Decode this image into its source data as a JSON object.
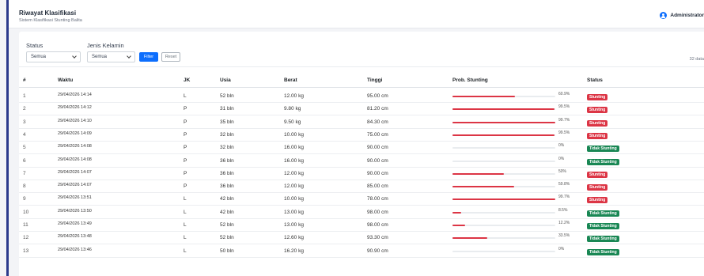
{
  "header": {
    "title": "Riwayat Klasifikasi",
    "subtitle": "Sistem Klasifikasi Stunting Balita",
    "user_name": "Administrator"
  },
  "filters": {
    "status_label": "Status",
    "status_value": "Semua",
    "gender_label": "Jenis Kelamin",
    "gender_value": "Semua",
    "filter_button": "Filter",
    "reset_button": "Reset",
    "count_text": "32 data"
  },
  "table": {
    "columns": [
      "#",
      "Waktu",
      "JK",
      "Usia",
      "Berat",
      "Tinggi",
      "Prob. Stunting",
      "Status"
    ],
    "rows": [
      {
        "no": "1",
        "time": "29/04/2026 14:14",
        "jk": "L",
        "usia": "52 bln",
        "berat": "12.00 kg",
        "tinggi": "95.00 cm",
        "prob": 60.9,
        "prob_text": "60.9%",
        "status": "Stunting",
        "positive": true
      },
      {
        "no": "2",
        "time": "29/04/2026 14:12",
        "jk": "P",
        "usia": "31 bln",
        "berat": "9.80 kg",
        "tinggi": "81.20 cm",
        "prob": 99.5,
        "prob_text": "99.5%",
        "status": "Stunting",
        "positive": true
      },
      {
        "no": "3",
        "time": "29/04/2026 14:10",
        "jk": "P",
        "usia": "35 bln",
        "berat": "9.50 kg",
        "tinggi": "84.30 cm",
        "prob": 99.7,
        "prob_text": "99.7%",
        "status": "Stunting",
        "positive": true
      },
      {
        "no": "4",
        "time": "29/04/2026 14:09",
        "jk": "P",
        "usia": "32 bln",
        "berat": "10.00 kg",
        "tinggi": "75.00 cm",
        "prob": 99.5,
        "prob_text": "99.5%",
        "status": "Stunting",
        "positive": true
      },
      {
        "no": "5",
        "time": "29/04/2026 14:08",
        "jk": "P",
        "usia": "32 bln",
        "berat": "16.00 kg",
        "tinggi": "90.00 cm",
        "prob": 0,
        "prob_text": "0%",
        "status": "Tidak Stunting",
        "positive": false
      },
      {
        "no": "6",
        "time": "29/04/2026 14:08",
        "jk": "P",
        "usia": "36 bln",
        "berat": "16.00 kg",
        "tinggi": "90.00 cm",
        "prob": 0,
        "prob_text": "0%",
        "status": "Tidak Stunting",
        "positive": false
      },
      {
        "no": "7",
        "time": "29/04/2026 14:07",
        "jk": "P",
        "usia": "36 bln",
        "berat": "12.00 kg",
        "tinggi": "90.00 cm",
        "prob": 50,
        "prob_text": "50%",
        "status": "Stunting",
        "positive": true
      },
      {
        "no": "8",
        "time": "29/04/2026 14:07",
        "jk": "P",
        "usia": "36 bln",
        "berat": "12.00 kg",
        "tinggi": "85.00 cm",
        "prob": 59.8,
        "prob_text": "59.8%",
        "status": "Stunting",
        "positive": true
      },
      {
        "no": "9",
        "time": "29/04/2026 13:51",
        "jk": "L",
        "usia": "42 bln",
        "berat": "10.00 kg",
        "tinggi": "78.00 cm",
        "prob": 99.7,
        "prob_text": "99.7%",
        "status": "Stunting",
        "positive": true
      },
      {
        "no": "10",
        "time": "29/04/2026 13:50",
        "jk": "L",
        "usia": "42 bln",
        "berat": "13.00 kg",
        "tinggi": "98.00 cm",
        "prob": 8.5,
        "prob_text": "8.5%",
        "status": "Tidak Stunting",
        "positive": false
      },
      {
        "no": "11",
        "time": "29/04/2026 13:49",
        "jk": "L",
        "usia": "52 bln",
        "berat": "13.00 kg",
        "tinggi": "98.00 cm",
        "prob": 12.2,
        "prob_text": "12.2%",
        "status": "Tidak Stunting",
        "positive": false
      },
      {
        "no": "12",
        "time": "29/04/2026 13:48",
        "jk": "L",
        "usia": "52 bln",
        "berat": "12.60 kg",
        "tinggi": "93.30 cm",
        "prob": 33.5,
        "prob_text": "33.5%",
        "status": "Tidak Stunting",
        "positive": false
      },
      {
        "no": "13",
        "time": "29/04/2026 13:46",
        "jk": "L",
        "usia": "50 bln",
        "berat": "16.20 kg",
        "tinggi": "90.90 cm",
        "prob": 0,
        "prob_text": "0%",
        "status": "Tidak Stunting",
        "positive": false
      }
    ]
  },
  "colors": {
    "primary": "#0d6efd",
    "danger": "#dc3545",
    "success": "#198754",
    "sidebar_edge": "#2b3a8c"
  }
}
